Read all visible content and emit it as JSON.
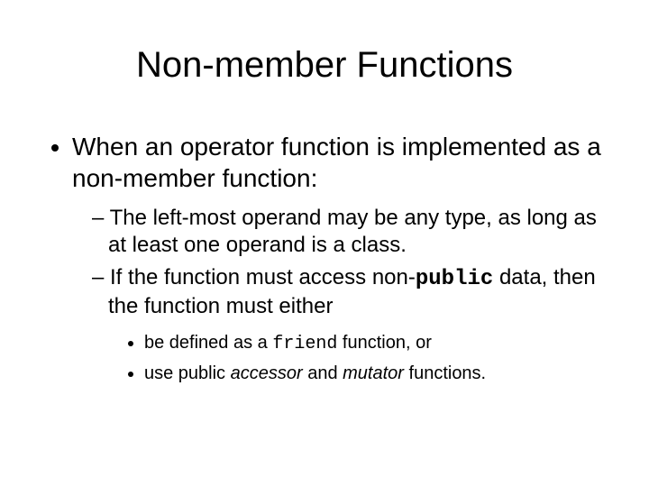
{
  "title": "Non-member Functions",
  "bullet1": "When an operator function is implemented as a non-member function:",
  "sub1": "The left-most operand may be any type, as long as at least one operand is a class.",
  "sub2_a": "If the function must access non-",
  "sub2_code": "public",
  "sub2_b": " data, then the function must either",
  "subsub1_a": "be defined as a ",
  "subsub1_code": "friend",
  "subsub1_b": " function, or",
  "subsub2_a": "use public ",
  "subsub2_i1": "accessor",
  "subsub2_b": " and ",
  "subsub2_i2": "mutator",
  "subsub2_c": " functions."
}
